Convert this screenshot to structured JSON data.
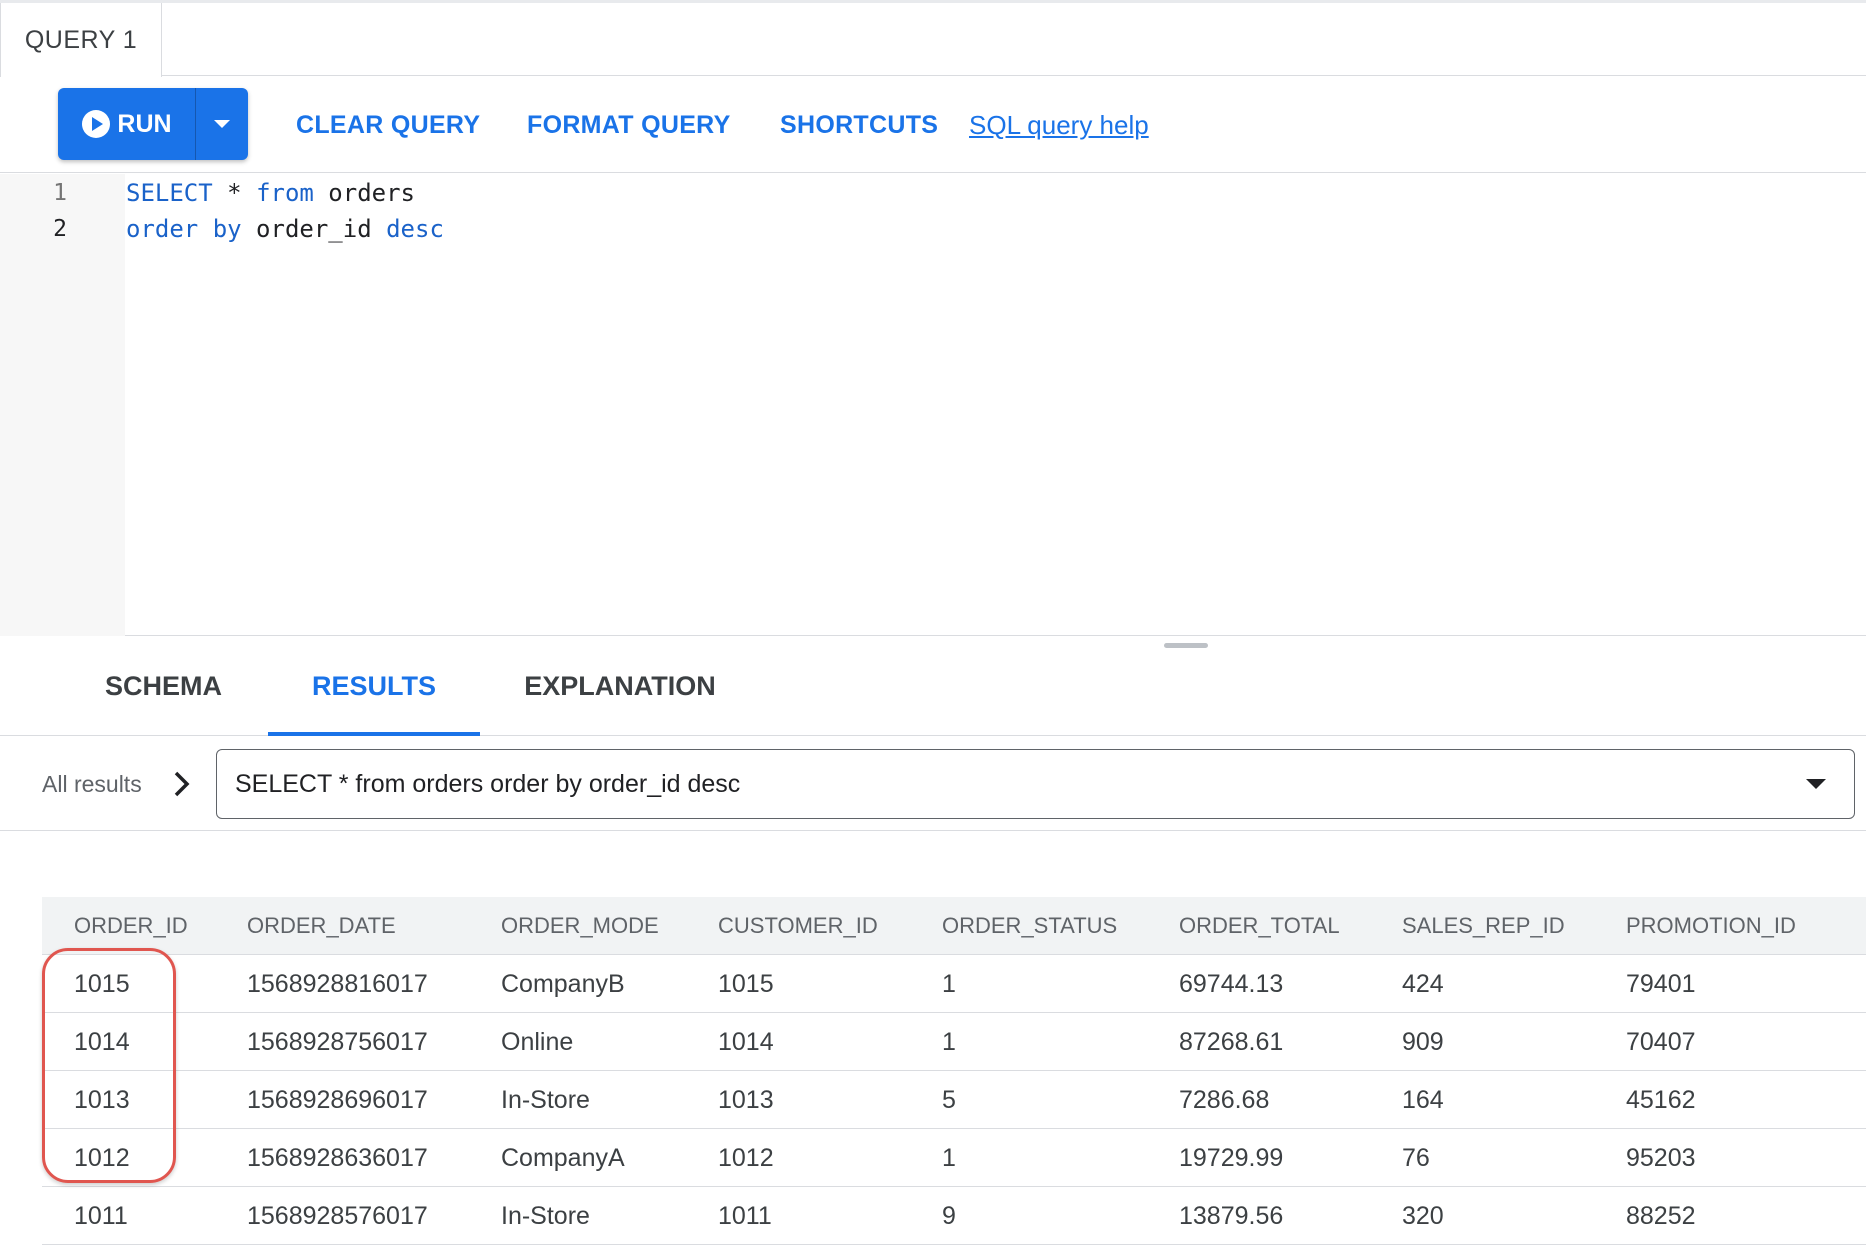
{
  "tabs": {
    "query_tab": "QUERY 1"
  },
  "toolbar": {
    "run_label": "RUN",
    "clear_label": "CLEAR QUERY",
    "format_label": "FORMAT QUERY",
    "shortcuts_label": "SHORTCUTS",
    "help_label": "SQL query help"
  },
  "editor": {
    "line_numbers": [
      "1",
      "2"
    ],
    "line1": {
      "select": "SELECT",
      "star": " * ",
      "from": "from",
      "table": " orders"
    },
    "line2": {
      "order": "order",
      "by": " by",
      "col": " order_id ",
      "desc": "desc"
    }
  },
  "bottom_tabs": {
    "schema": "SCHEMA",
    "results": "RESULTS",
    "explanation": "EXPLANATION"
  },
  "results_selector": {
    "all_results": "All results",
    "selected_query": "SELECT * from orders order by order_id desc"
  },
  "table": {
    "columns": [
      "ORDER_ID",
      "ORDER_DATE",
      "ORDER_MODE",
      "CUSTOMER_ID",
      "ORDER_STATUS",
      "ORDER_TOTAL",
      "SALES_REP_ID",
      "PROMOTION_ID"
    ],
    "rows": [
      [
        "1015",
        "1568928816017",
        "CompanyB",
        "1015",
        "1",
        "69744.13",
        "424",
        "79401"
      ],
      [
        "1014",
        "1568928756017",
        "Online",
        "1014",
        "1",
        "87268.61",
        "909",
        "70407"
      ],
      [
        "1013",
        "1568928696017",
        "In-Store",
        "1013",
        "5",
        "7286.68",
        "164",
        "45162"
      ],
      [
        "1012",
        "1568928636017",
        "CompanyA",
        "1012",
        "1",
        "19729.99",
        "76",
        "95203"
      ],
      [
        "1011",
        "1568928576017",
        "In-Store",
        "1011",
        "9",
        "13879.56",
        "320",
        "88252"
      ]
    ]
  },
  "colors": {
    "accent": "#1a73e8",
    "highlight": "#e0564f",
    "keyword": "#1a62c9"
  }
}
